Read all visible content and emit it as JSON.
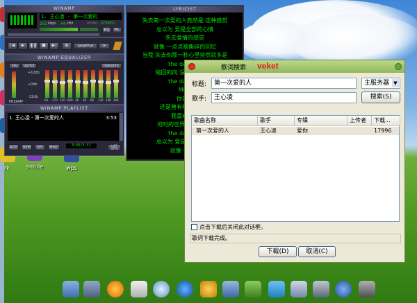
{
  "winamp": {
    "main_title": "WINAMP",
    "marquee": "1. 王心凌 - 第一次爱的",
    "kbps": "192",
    "kbps_unit": "kbps",
    "khz": "44",
    "khz_unit": "kHz",
    "mono": "MONO",
    "stereo": "STEREO",
    "eq_toggle": "EQ",
    "pl_toggle": "PL",
    "shuffle": "SHUFFLE",
    "equalizer_title": "WINAMP EQUALIZER",
    "eq_on": "ON",
    "eq_auto": "AUTO",
    "eq_presets": "PRESETS",
    "eq_plus": "+12db",
    "eq_zero": "+0db",
    "eq_minus": "-12db",
    "eq_preamp": "PREAMP",
    "eq_bands": [
      "60",
      "170",
      "310",
      "600",
      "1K",
      "3K",
      "6K",
      "12K",
      "14K",
      "16K"
    ],
    "playlist_title": "WINAMP PLAYLIST",
    "playlist_items": [
      {
        "text": "1. 王心凌 - 第一次爱的人",
        "time": "3:53"
      }
    ],
    "pl_buttons": [
      "ADD",
      "REM",
      "SEL",
      "MISC"
    ],
    "pl_time": "0:00/3:53",
    "pl_list": "LIST OPTS"
  },
  "lyrics": {
    "title": "LYRICIST",
    "lines": [
      "失去第一次爱的人竟然是 这种感觉",
      "总以为 爱是全部的心情",
      "失去爱情的感觉",
      "就像 一点点被撕碎的回忆",
      "当我 失去你那一秒心里突然就多是",
      "the day you",
      "缩回的向 没是想追回 爱",
      "the day you",
      "Mh~",
      "你是您",
      "还是曾有相同的感觉",
      "我喜欢你这",
      "何时的世界能有你一天",
      "the day you",
      "总以为 爱是全部的心情",
      "就像 一点点"
    ]
  },
  "desktop_icons": [
    "rk",
    "smule",
    "wps"
  ],
  "dialog": {
    "title": "歌词搜索",
    "brand": "veket",
    "title_label": "标题:",
    "title_value": "第一次爱的人",
    "artist_label": "歌手:",
    "artist_value": "王心凌",
    "server_value": "主服务器",
    "search_button": "搜索(S)",
    "columns": [
      "歌曲名称",
      "歌手",
      "专辑",
      "上传者",
      "下载..."
    ],
    "results": [
      {
        "song": "第一次爱的人",
        "artist": "王心凌",
        "album": "爱你",
        "uploader": "",
        "downloads": "17996"
      }
    ],
    "checkbox_label": "点击下载后关闭此对话框。",
    "status": "歌词下载完成。",
    "download_button": "下载(D)",
    "cancel_button": "取消(C)"
  },
  "colors": {
    "lcd_green": "#00e000",
    "dialog_title": "#90b85a",
    "brand": "#e02020"
  }
}
